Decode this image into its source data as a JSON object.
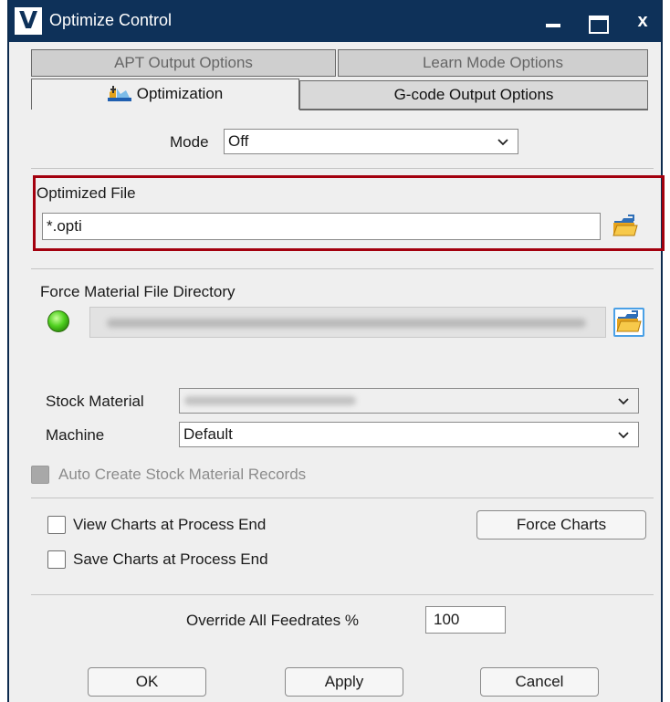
{
  "window": {
    "title": "Optimize Control",
    "logo_letter": "V",
    "controls": {
      "minimize_icon": "minimize-icon",
      "maximize_icon": "maximize-icon",
      "close_label": "x"
    }
  },
  "tabs": {
    "back_row": [
      {
        "label": "APT Output Options"
      },
      {
        "label": "Learn Mode Options"
      }
    ],
    "front_row": [
      {
        "label": "Optimization",
        "active": true,
        "icon": "optimization-icon"
      },
      {
        "label": "G-code Output Options",
        "active": false
      }
    ]
  },
  "mode": {
    "label": "Mode",
    "value": "Off"
  },
  "optimized_file": {
    "label": "Optimized File",
    "value": "*.opti",
    "browse_icon": "open-folder-icon"
  },
  "force_material": {
    "label": "Force Material File Directory",
    "status_icon": "green-status-led-icon",
    "browse_icon": "open-folder-icon"
  },
  "stock_material": {
    "label": "Stock Material"
  },
  "machine": {
    "label": "Machine",
    "value": "Default"
  },
  "auto_create": {
    "label": "Auto Create Stock Material Records",
    "checked": false,
    "enabled": false
  },
  "charts": {
    "view_label": "View Charts at Process End",
    "save_label": "Save Charts at Process End",
    "force_button": "Force Charts"
  },
  "override": {
    "label": "Override All Feedrates %",
    "value": "100"
  },
  "footer": {
    "ok": "OK",
    "apply": "Apply",
    "cancel": "Cancel"
  },
  "colors": {
    "titlebar": "#0e3159",
    "highlight": "#a3000e",
    "led": "#4fd01f",
    "focus": "#4aa0e6"
  }
}
